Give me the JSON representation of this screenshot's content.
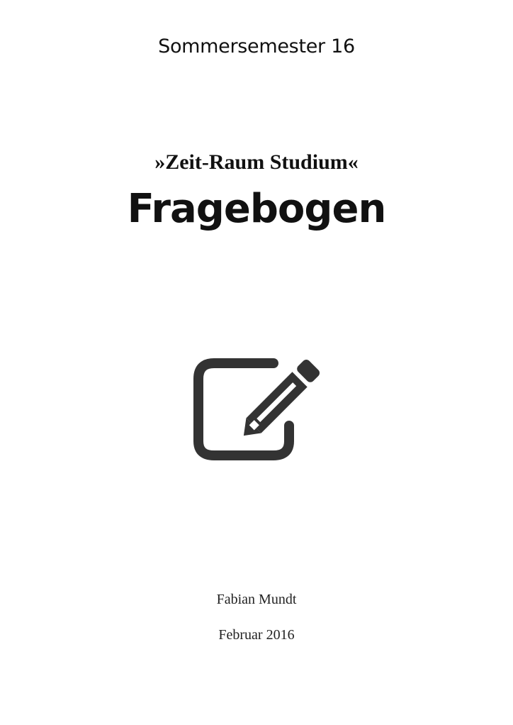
{
  "header": {
    "semester": "Sommersemester 16"
  },
  "title_block": {
    "subtitle": "»Zeit-Raum Studium«",
    "title": "Fragebogen"
  },
  "icon": {
    "name": "edit-icon",
    "color": "#333333"
  },
  "footer": {
    "author": "Fabian Mundt",
    "date": "Februar 2016"
  }
}
